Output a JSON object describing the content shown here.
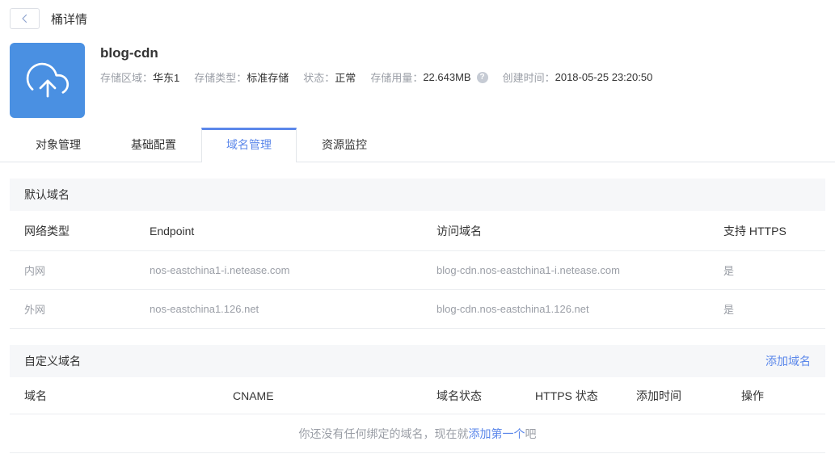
{
  "colors": {
    "accent": "#5b87ea",
    "icon_bg": "#4a90e2"
  },
  "topbar": {
    "title": "桶详情"
  },
  "bucket": {
    "name": "blog-cdn",
    "meta": [
      {
        "label": "存储区域：",
        "value": "华东1"
      },
      {
        "label": "存储类型：",
        "value": "标准存储"
      },
      {
        "label": "状态：",
        "value": "正常"
      },
      {
        "label": "存储用量：",
        "value": "22.643MB"
      },
      {
        "label": "创建时间：",
        "value": "2018-05-25 23:20:50"
      }
    ],
    "usage_help_icon": "?"
  },
  "tabs": [
    {
      "label": "对象管理",
      "active": false
    },
    {
      "label": "基础配置",
      "active": false
    },
    {
      "label": "域名管理",
      "active": true
    },
    {
      "label": "资源监控",
      "active": false
    }
  ],
  "default_domains": {
    "section_title": "默认域名",
    "headers": [
      "网络类型",
      "Endpoint",
      "访问域名",
      "支持 HTTPS"
    ],
    "rows": [
      [
        "内网",
        "nos-eastchina1-i.netease.com",
        "blog-cdn.nos-eastchina1-i.netease.com",
        "是"
      ],
      [
        "外网",
        "nos-eastchina1.126.net",
        "blog-cdn.nos-eastchina1.126.net",
        "是"
      ]
    ]
  },
  "custom_domains": {
    "section_title": "自定义域名",
    "add_link": "添加域名",
    "headers": [
      "域名",
      "CNAME",
      "域名状态",
      "HTTPS 状态",
      "添加时间",
      "操作"
    ],
    "empty": {
      "prefix": "你还没有任何绑定的域名，现在就",
      "link": "添加第一个",
      "suffix": "吧"
    }
  }
}
